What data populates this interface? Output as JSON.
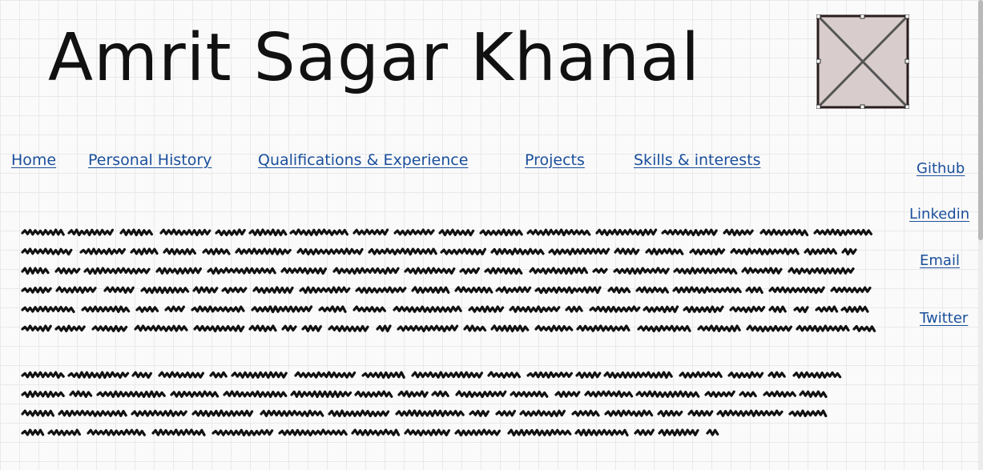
{
  "header": {
    "title": "Amrit Sagar Khanal",
    "image_icon": "image-placeholder-icon"
  },
  "nav": {
    "items": [
      {
        "label": "Home"
      },
      {
        "label": "Personal History"
      },
      {
        "label": "Qualifications & Experience"
      },
      {
        "label": "Projects"
      },
      {
        "label": "Skills & interests"
      }
    ]
  },
  "social": {
    "items": [
      {
        "label": "Github"
      },
      {
        "label": "Linkedin"
      },
      {
        "label": "Email"
      },
      {
        "label": "Twitter"
      }
    ]
  },
  "colors": {
    "link": "#1a4f9c",
    "text": "#111111",
    "placeholder_fill": "#d8cccc"
  }
}
